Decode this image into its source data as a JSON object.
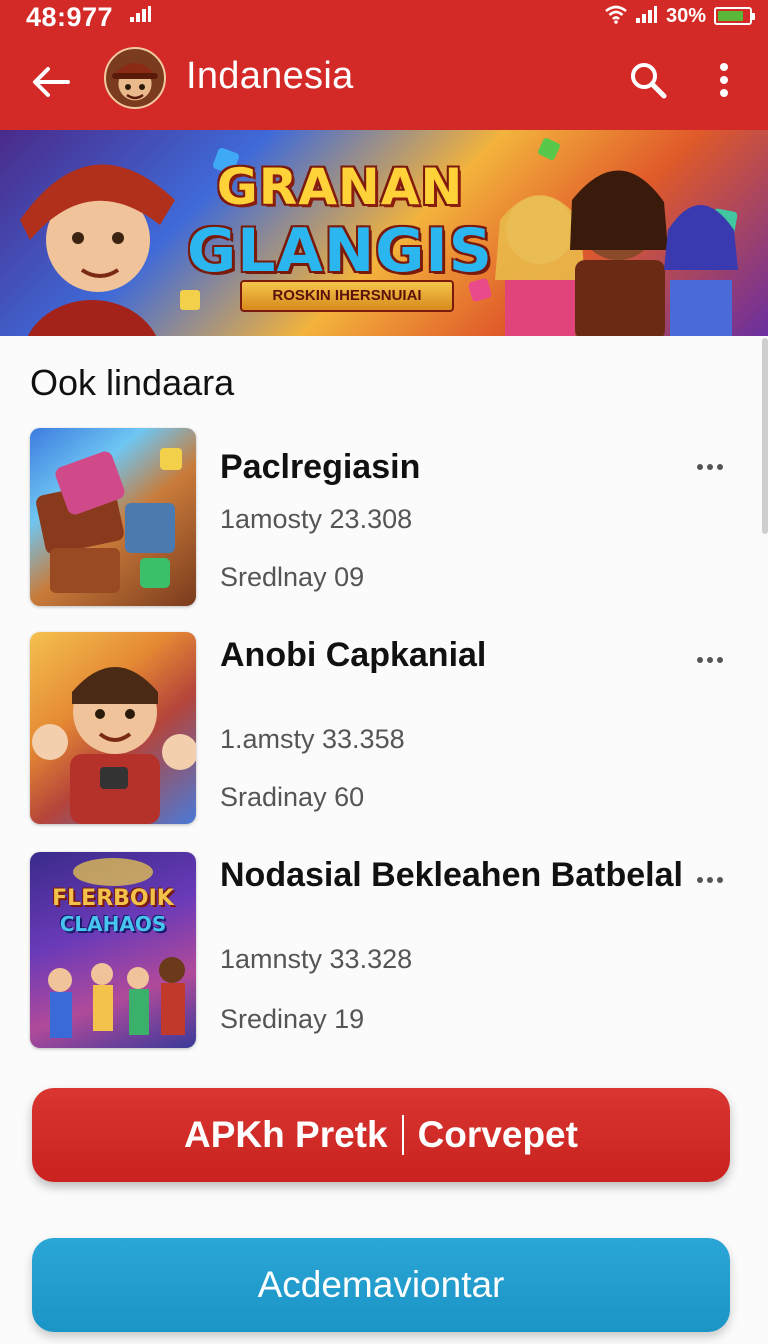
{
  "status_bar": {
    "time": "48:977",
    "battery_text": "30%",
    "battery_level": 0.85,
    "icons": [
      "signal-icon",
      "wifi-icon",
      "signal-icon",
      "battery-icon"
    ]
  },
  "app_bar": {
    "title": "Indanesia",
    "icons": [
      "back-arrow-icon",
      "search-icon",
      "more-vert-icon"
    ],
    "background": "#d42a27"
  },
  "banner": {
    "title_line1": "GRANAN",
    "title_line2": "GLANGIS",
    "ribbon": "ROSKIN IHERSNUIAI"
  },
  "section": {
    "title": "Ook lindaara"
  },
  "games": [
    {
      "name": "Paclregiasin",
      "meta1": "1amosty 23.308",
      "meta2": "Sredlnay 09"
    },
    {
      "name": "Anobi Capkanial",
      "meta1": "1.amsty 33.358",
      "meta2": "Sradinay 60"
    },
    {
      "name": "Nodasial Bekleahen Batbelal",
      "meta1": "1amnsty 33.328",
      "meta2": "Sredinay 19"
    }
  ],
  "game3_thumb_text": {
    "line1": "FLERBOIK",
    "line2": "CLAHAOS"
  },
  "buttons": {
    "primary_left": "APKh Pretk",
    "primary_right": "Corvepet",
    "secondary": "Acdemaviontar"
  },
  "colors": {
    "accent_red": "#d42a27",
    "accent_blue": "#1b94c6"
  }
}
